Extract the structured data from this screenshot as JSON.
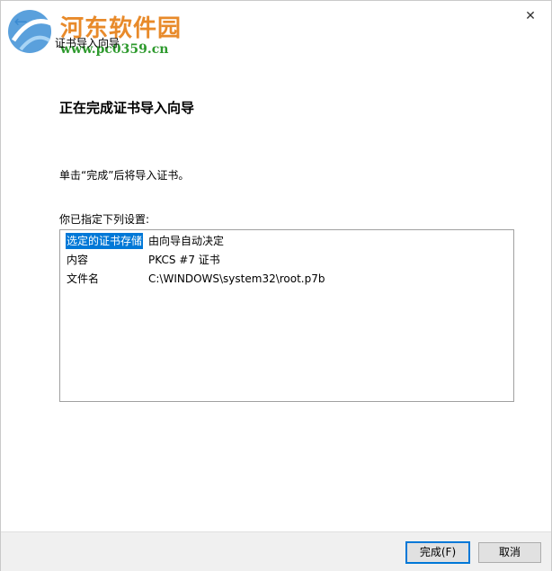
{
  "window": {
    "title": "证书导入向导",
    "close_glyph": "✕",
    "back_glyph": "←"
  },
  "watermark": {
    "name": "河东软件园",
    "url": "www.pc0359.cn"
  },
  "page": {
    "heading": "正在完成证书导入向导",
    "instruction": "单击“完成”后将导入证书。",
    "spec_label": "你已指定下列设置:"
  },
  "settings": [
    {
      "key": "选定的证书存储",
      "value": "由向导自动决定",
      "selected": true
    },
    {
      "key": "内容",
      "value": "PKCS #7 证书",
      "selected": false
    },
    {
      "key": "文件名",
      "value": "C:\\WINDOWS\\system32\\root.p7b",
      "selected": false
    }
  ],
  "buttons": {
    "finish": "完成(F)",
    "cancel": "取消"
  },
  "colors": {
    "accent": "#0078d7",
    "watermark_orange": "#e88a2a",
    "watermark_green": "#2e9a2e"
  }
}
